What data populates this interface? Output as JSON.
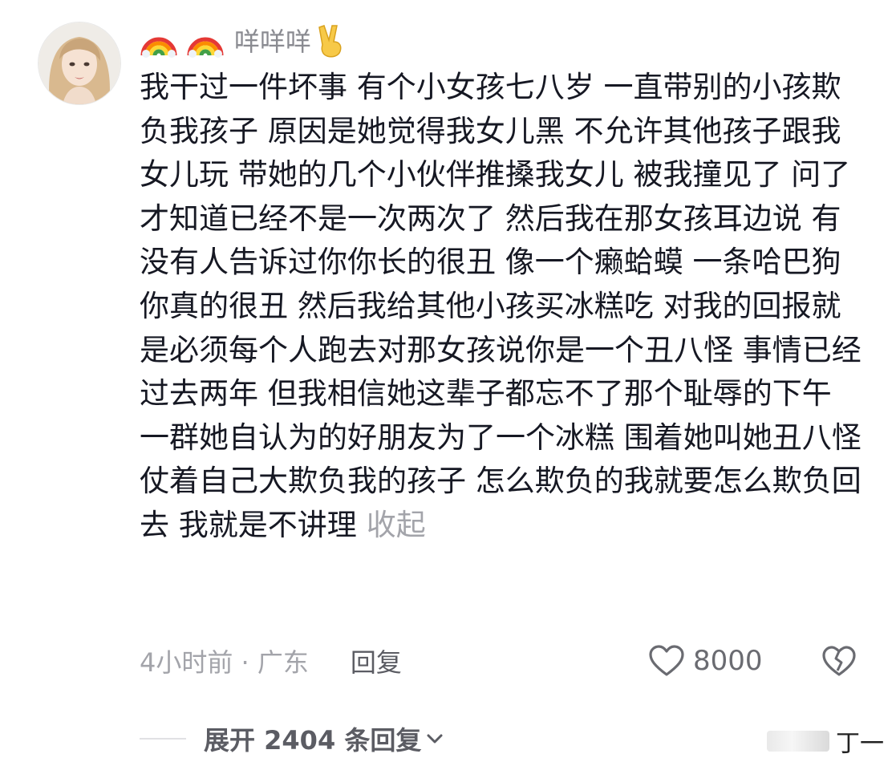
{
  "comment": {
    "user": {
      "name": "咩咩咩",
      "leading_emojis": [
        "rainbow-icon",
        "rainbow-icon"
      ],
      "trailing_emoji": "victory-hand-icon"
    },
    "text": "我干过一件坏事 有个小女孩七八岁 一直带别的小孩欺负我孩子 原因是她觉得我女儿黑 不允许其他孩子跟我女儿玩 带她的几个小伙伴推搡我女儿 被我撞见了 问了才知道已经不是一次两次了 然后我在那女孩耳边说 有没有人告诉过你你长的很丑 像一个癞蛤蟆 一条哈巴狗 你真的很丑 然后我给其他小孩买冰糕吃 对我的回报就是必须每个人跑去对那女孩说你是一个丑八怪 事情已经过去两年 但我相信她这辈子都忘不了那个耻辱的下午 一群她自认为的好朋友为了一个冰糕 围着她叫她丑八怪 仗着自己大欺负我的孩子 怎么欺负的我就要怎么欺负回去 我就是不讲理",
    "collapse_label": "收起",
    "time_location": "4小时前 · 广东",
    "reply_label": "回复",
    "like_count": "8000"
  },
  "replies": {
    "expand_label": "展开 2404 条回复"
  },
  "watermark": {
    "text": "丁一"
  },
  "colors": {
    "primary_text": "#161823",
    "secondary_text": "#a3a4aa",
    "username": "#8a8b91"
  }
}
